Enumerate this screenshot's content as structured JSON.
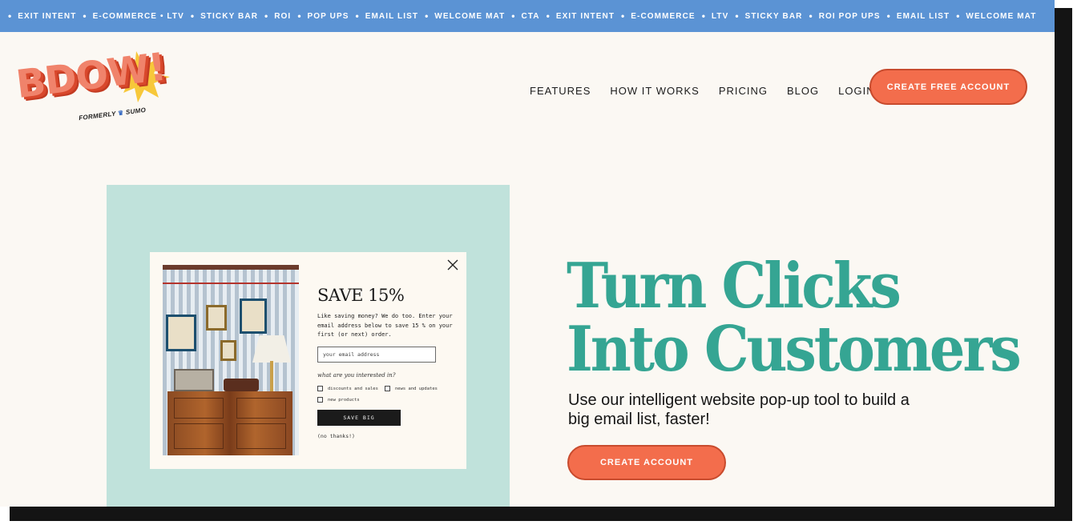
{
  "ticker": {
    "items": [
      "EXIT INTENT",
      "E-COMMERCE • LTV",
      "STICKY BAR",
      "ROI",
      "POP UPS",
      "EMAIL LIST",
      "WELCOME MAT",
      "CTA",
      "EXIT INTENT",
      "E-COMMERCE",
      "LTV",
      "STICKY BAR",
      "ROI POP UPS",
      "EMAIL LIST",
      "WELCOME MAT"
    ],
    "separator": "•",
    "background_color": "#5b93d4"
  },
  "logo": {
    "wordmark": "BDOW!",
    "formerly_prefix": "FORMERLY",
    "formerly_name": "SUMO"
  },
  "nav": {
    "items": [
      "FEATURES",
      "HOW IT WORKS",
      "PRICING",
      "BLOG",
      "LOGIN"
    ],
    "cta_label": "CREATE FREE ACCOUNT"
  },
  "popup": {
    "title": "SAVE 15%",
    "description": "Like saving money? We do too. Enter your email address below to save 15 % on your first (or next) order.",
    "email_placeholder": "your email address",
    "question": "what are you interested in?",
    "options": [
      "discounts and sales",
      "news and updates",
      "new products"
    ],
    "submit_label": "SAVE BIG",
    "decline_label": "(no thanks!)"
  },
  "hero": {
    "headline_line1": "Turn Clicks",
    "headline_line2": "Into Customers",
    "subheadline": "Use our intelligent website pop-up tool to build a big email list, faster!",
    "cta_label": "CREATE ACCOUNT"
  },
  "colors": {
    "accent_orange": "#f36d4c",
    "headline_teal": "#35a593",
    "mint_panel": "#c0e2db",
    "page_bg": "#fbf8f3"
  }
}
